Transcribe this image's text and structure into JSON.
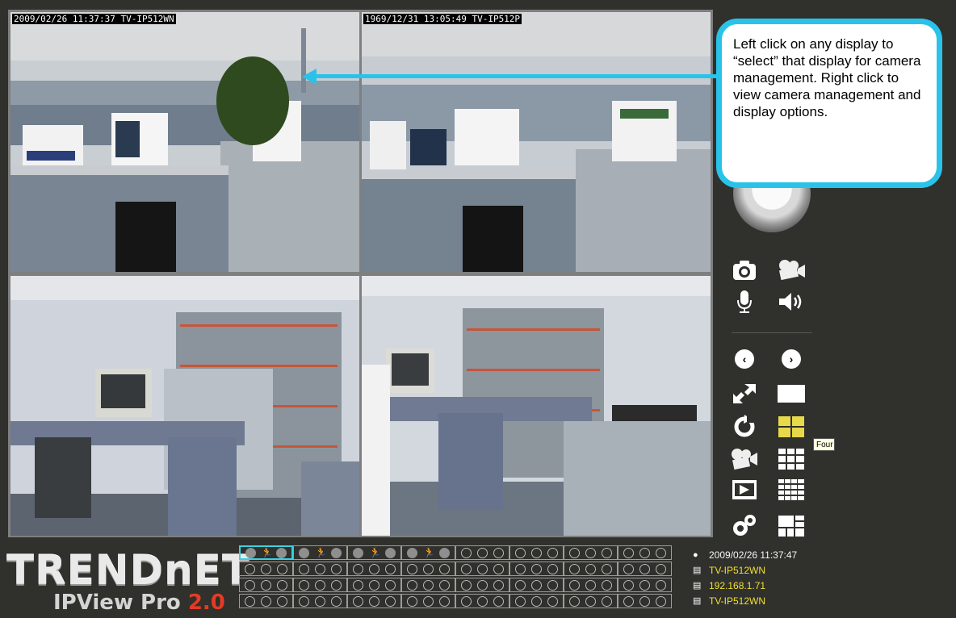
{
  "window": {
    "app_name": "IPView Pro 2.0"
  },
  "views": [
    {
      "timestamp": "2009/02/26 11:37:37 TV-IP512WN",
      "selected": true
    },
    {
      "timestamp": "1969/12/31 13:05:49 TV-IP512P",
      "selected": false
    },
    {
      "timestamp": "",
      "selected": false
    },
    {
      "timestamp": "",
      "selected": false
    }
  ],
  "callout": {
    "text": "Left click on any display to “select” that display for camera management. Right click to view camera management and display options."
  },
  "panel": {
    "icons": [
      "camera-snapshot-icon",
      "record-video-icon",
      "microphone-icon",
      "speaker-icon",
      "previous-icon",
      "next-icon",
      "fullscreen-icon",
      "single-screen-icon",
      "refresh-icon",
      "four-screen-icon",
      "playback-icon",
      "nine-screen-icon",
      "video-player-icon",
      "sixteen-screen-icon",
      "settings-icon",
      "custom-layout-icon"
    ],
    "tooltip": "Four scre"
  },
  "logo": {
    "brand": "TRENDnET",
    "product": "IPView Pro",
    "version": "2.0"
  },
  "status": {
    "datetime": "2009/02/26 11:37:47",
    "camera_name": "TV-IP512WN",
    "ip_address": "192.168.1.71",
    "model": "TV-IP512WN"
  },
  "colors": {
    "accent": "#29c3ea",
    "selection": "#3dd0e0",
    "status_yellow": "#f0e030",
    "version_red": "#e43b24"
  }
}
